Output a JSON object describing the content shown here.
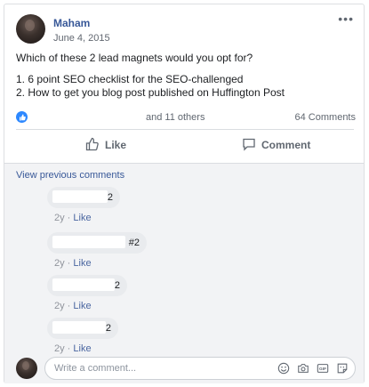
{
  "post": {
    "author": "Maham",
    "date": "June 4, 2015",
    "text_question": "Which of these 2 lead magnets would you opt for?",
    "text_option_1": "1. 6 point SEO checklist for the SEO-challenged",
    "text_option_2": "2. How to get you blog post published on Huffington Post",
    "reactions_text": "and 11 others",
    "comments_count": "64 Comments",
    "like_label": "Like",
    "comment_label": "Comment"
  },
  "comments": {
    "view_previous": "View previous comments",
    "items": [
      {
        "text": "2",
        "time": "2y",
        "like": "Like"
      },
      {
        "text": "#2",
        "time": "2y",
        "like": "Like"
      },
      {
        "text": "2",
        "time": "2y",
        "like": "Like"
      },
      {
        "text": "2",
        "time": "2y",
        "like": "Like"
      }
    ]
  },
  "composer": {
    "placeholder": "Write a comment..."
  },
  "icons": {
    "more": "more-options-icon",
    "like_badge": "thumbs-up-badge-icon",
    "like_action": "thumbs-up-icon",
    "comment_action": "speech-bubble-icon",
    "emoji": "emoji-icon",
    "camera": "camera-icon",
    "gif": "gif-icon",
    "sticker": "sticker-icon"
  },
  "colors": {
    "link": "#385898",
    "like_blue": "#2d88ff",
    "muted": "#606770"
  }
}
